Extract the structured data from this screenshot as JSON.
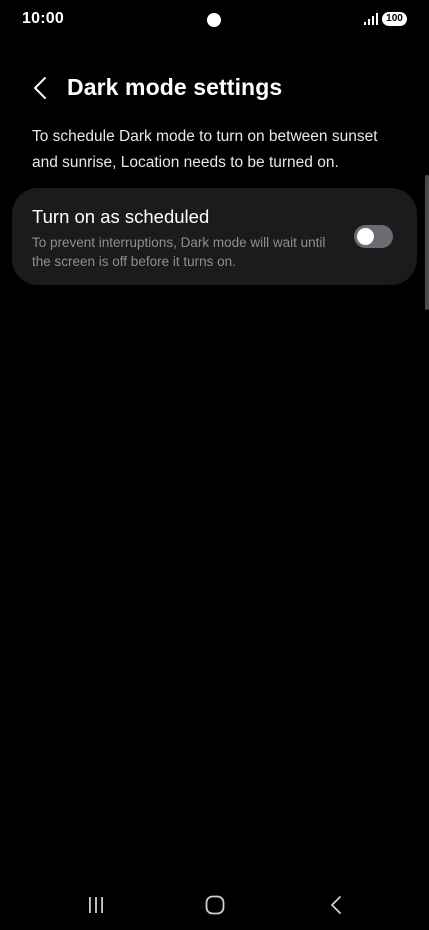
{
  "status_bar": {
    "time": "10:00",
    "battery": "100"
  },
  "header": {
    "title": "Dark mode settings"
  },
  "description": "To schedule Dark mode to turn on between sunset and sunrise, Location needs to be turned on.",
  "setting": {
    "title": "Turn on as scheduled",
    "description": "To prevent interruptions, Dark mode will wait until the screen is off before it turns on.",
    "enabled": false
  },
  "icons": {
    "back": "back-arrow-icon",
    "signal": "signal-icon",
    "recents": "recents-icon",
    "home": "home-icon",
    "nav_back": "nav-back-icon"
  },
  "colors": {
    "background": "#000000",
    "card": "#1b1b1d",
    "toggle_off": "#6b6b70",
    "secondary_text": "#8e8e93"
  }
}
